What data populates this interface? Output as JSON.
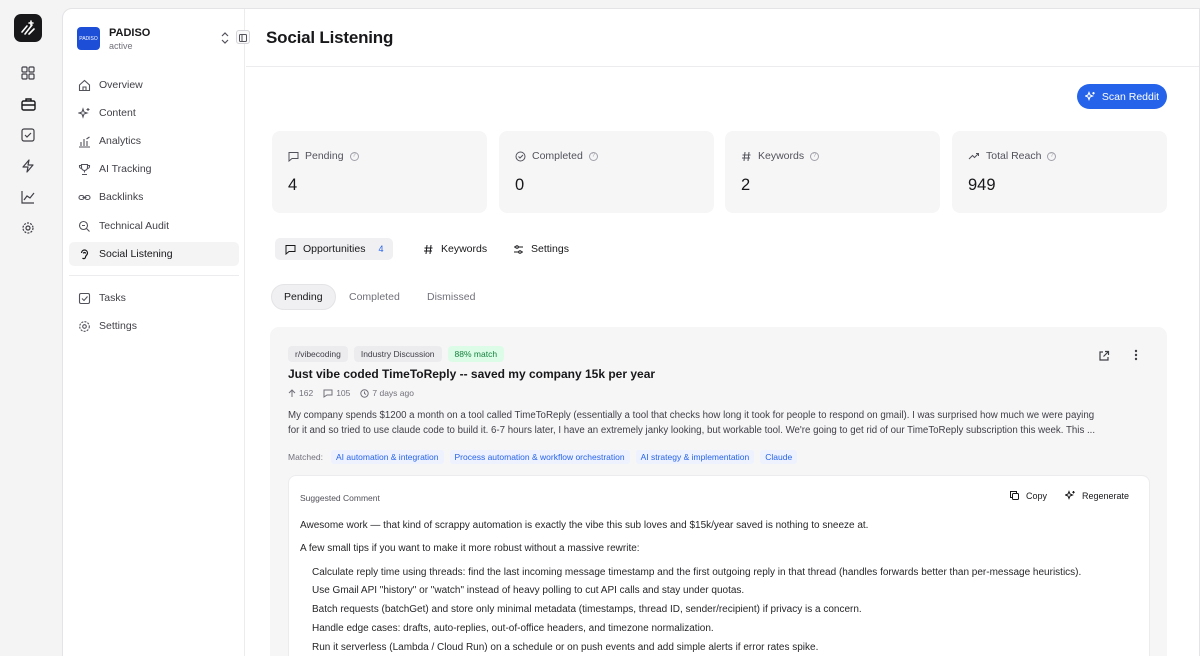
{
  "org": {
    "logo_text": "PADISO",
    "name": "PADISO",
    "status": "active"
  },
  "nav": {
    "items": [
      {
        "label": "Overview",
        "icon": "home-icon"
      },
      {
        "label": "Content",
        "icon": "sparkles-icon"
      },
      {
        "label": "Analytics",
        "icon": "bar-chart-icon"
      },
      {
        "label": "AI Tracking",
        "icon": "trophy-icon"
      },
      {
        "label": "Backlinks",
        "icon": "link-icon"
      },
      {
        "label": "Technical Audit",
        "icon": "search-icon"
      },
      {
        "label": "Social Listening",
        "icon": "ear-icon",
        "active": true
      }
    ],
    "bottom": [
      {
        "label": "Tasks",
        "icon": "checkbox-icon"
      },
      {
        "label": "Settings",
        "icon": "gear-icon"
      }
    ]
  },
  "page": {
    "title": "Social Listening"
  },
  "actions": {
    "scan_label": "Scan Reddit"
  },
  "stats": [
    {
      "label": "Pending",
      "value": "4",
      "icon": "message-square-icon"
    },
    {
      "label": "Completed",
      "value": "0",
      "icon": "check-circle-icon"
    },
    {
      "label": "Keywords",
      "value": "2",
      "icon": "hash-icon"
    },
    {
      "label": "Total Reach",
      "value": "949",
      "icon": "trending-up-icon"
    }
  ],
  "tabs": [
    {
      "label": "Opportunities",
      "badge": "4",
      "active": true
    },
    {
      "label": "Keywords"
    },
    {
      "label": "Settings"
    }
  ],
  "subtabs": [
    {
      "label": "Pending",
      "active": true
    },
    {
      "label": "Completed"
    },
    {
      "label": "Dismissed"
    }
  ],
  "post": {
    "subreddit": "r/vibecoding",
    "category": "Industry Discussion",
    "match": "88% match",
    "title": "Just vibe coded TimeToReply -- saved my company 15k per year",
    "upvotes": "162",
    "comments": "105",
    "time": "7 days ago",
    "body_line1": "My company spends $1200 a month on a tool called TimeToReply (essentially a tool that checks how long it took for people to respond on gmail). I was surprised how much we were paying",
    "body_line2": "for it and so tried to use claude code to build it. 6-7 hours later, I have an extremely janky looking, but workable tool. We're going to get rid of our TimeToReply subscription this week. This ...",
    "matched_label": "Matched:",
    "matched": [
      "AI automation & integration",
      "Process automation & workflow orchestration",
      "AI strategy & implementation",
      "Claude"
    ]
  },
  "suggestion": {
    "label": "Suggested Comment",
    "copy": "Copy",
    "regenerate": "Regenerate",
    "intro": "Awesome work — that kind of scrappy automation is exactly the vibe this sub loves and $15k/year saved is nothing to sneeze at.",
    "lead": "A few small tips if you want to make it more robust without a massive rewrite:",
    "tips": [
      "Calculate reply time using threads: find the last incoming message timestamp and the first outgoing reply in that thread (handles forwards better than per-message heuristics).",
      "Use Gmail API \"history\" or \"watch\" instead of heavy polling to cut API calls and stay under quotas.",
      "Batch requests (batchGet) and store only minimal metadata (timestamps, thread ID, sender/recipient) if privacy is a concern.",
      "Handle edge cases: drafts, auto-replies, out-of-office headers, and timezone normalization.",
      "Run it serverless (Lambda / Cloud Run) on a schedule or on push events and add simple alerts if error rates spike."
    ]
  },
  "rail": {
    "icons": [
      "apps-grid-icon",
      "briefcase-icon",
      "check-square-icon",
      "bolt-icon",
      "chart-line-icon",
      "gear-icon"
    ]
  },
  "colors": {
    "accent": "#2563eb",
    "match_bg": "#dcfce7",
    "match_text": "#15803d"
  }
}
